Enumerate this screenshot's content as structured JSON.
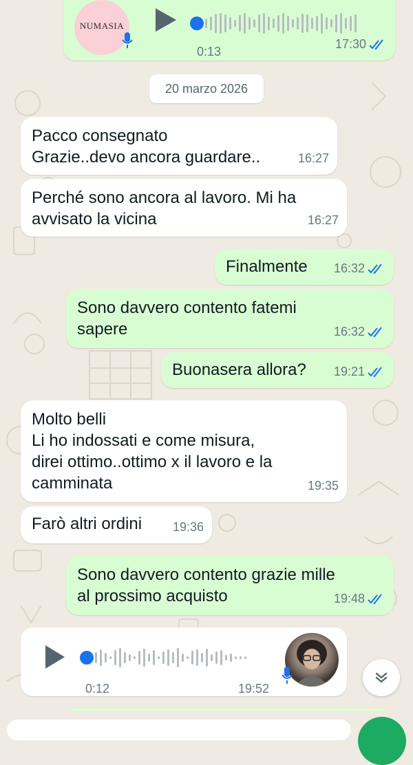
{
  "top_voice": {
    "brand": "NUMASIA",
    "duration": "0:13",
    "time": "17:30"
  },
  "date_chip": "20 marzo 2026",
  "messages": [
    {
      "text": "Pacco consegnato\nGrazie..devo ancora guardare..",
      "time": "16:27"
    },
    {
      "text": "Perché sono ancora al lavoro. Mi ha\navvisato la vicina",
      "time": "16:27"
    },
    {
      "text": "Finalmente",
      "time": "16:32"
    },
    {
      "text": "Sono davvero contento fatemi\nsapere",
      "time": "16:32"
    },
    {
      "text": "Buonasera allora?",
      "time": "19:21"
    },
    {
      "text": "Molto belli\nLi ho indossati e come misura,\ndirei ottimo..ottimo x il lavoro e la\ncamminata",
      "time": "19:35"
    },
    {
      "text": "Farò altri ordini",
      "time": "19:36"
    },
    {
      "text": "Sono davvero contento grazie mille\nal prossimo acquisto",
      "time": "19:48"
    }
  ],
  "bottom_voice": {
    "duration": "0:12",
    "time": "19:52"
  },
  "colors": {
    "incoming": "#ffffff",
    "outgoing": "#d9fdd3",
    "read_ticks": "#53bdeb",
    "accent_dot": "#1a73e8"
  }
}
